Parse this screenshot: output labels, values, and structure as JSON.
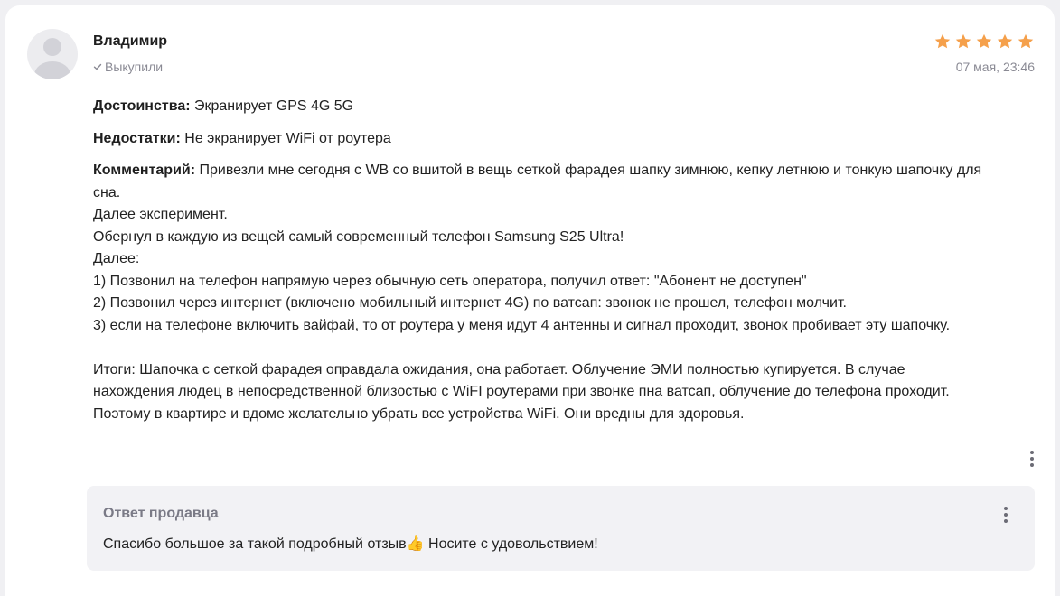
{
  "review": {
    "author": "Владимир",
    "verified_label": "Выкупили",
    "rating": 5,
    "date": "07 мая, 23:46",
    "star_color": "#f5a04b",
    "pros_label": "Достоинства:",
    "pros_text": " Экранирует GPS 4G 5G",
    "cons_label": "Недостатки:",
    "cons_text": " Не экранирует WiFi от роутера",
    "comment_label": "Комментарий:",
    "comment_text": " Привезли мне сегодня с WB со вшитой в вещь сеткой фарадея шапку зимнюю, кепку летнюю и тонкую шапочку для сна.\nДалее эксперимент.\nОбернул в каждую из вещей самый современный телефон Samsung S25 Ultra!\nДалее:\n1) Позвонил на телефон напрямую через обычную сеть оператора, получил ответ: \"Абонент не доступен\"\n2) Позвонил через интернет (включено мобильный интернет 4G) по ватсап: звонок не прошел, телефон молчит.\n3) если на телефоне включить вайфай, то от роутера у меня идут 4 антенны и сигнал проходит, звонок пробивает эту шапочку.\n\nИтоги: Шапочка с сеткой фарадея оправдала ожидания, она работает. Облучение ЭМИ полностью купируется. В случае нахождения людец в непосредственной близостью с WiFI роутерами при звонке пна ватсап, облучение до телефона проходит. Поэтому в квартире и вдоме желательно убрать все устройства WiFi. Они вредны для здоровья."
  },
  "seller_reply": {
    "title": "Ответ продавца",
    "text": "Спасибо большое за такой подробный отзыв👍 Носите с удовольствием!"
  },
  "icons": {
    "avatar": "user-avatar-icon",
    "check": "check-icon",
    "star": "star-icon",
    "more": "more-vertical-icon"
  }
}
